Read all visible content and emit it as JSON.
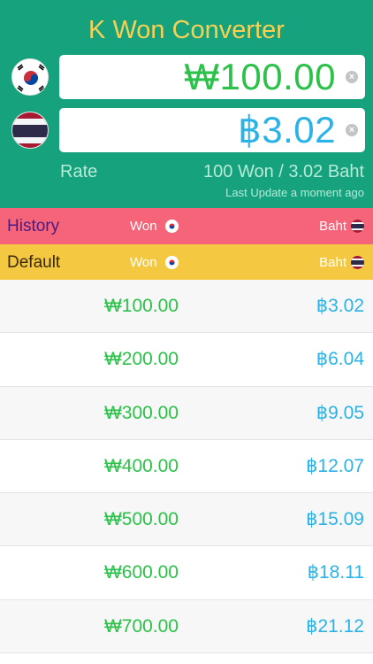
{
  "header": {
    "title": "K Won Converter",
    "won_value": "₩100.00",
    "baht_value": "฿3.02",
    "rate_label": "Rate",
    "rate_value": "100 Won / 3.02 Baht",
    "last_update": "Last Update a moment ago",
    "won_color": "#2cc24a",
    "baht_color": "#2bb2e6",
    "bg_color": "#16a27c"
  },
  "bars": {
    "history": {
      "label": "History",
      "won": "Won",
      "baht": "Baht",
      "color": "#f56478"
    },
    "default": {
      "label": "Default",
      "won": "Won",
      "baht": "Baht",
      "color": "#f5c842"
    }
  },
  "rows": [
    {
      "won": "₩100.00",
      "baht": "฿3.02"
    },
    {
      "won": "₩200.00",
      "baht": "฿6.04"
    },
    {
      "won": "₩300.00",
      "baht": "฿9.05"
    },
    {
      "won": "₩400.00",
      "baht": "฿12.07"
    },
    {
      "won": "₩500.00",
      "baht": "฿15.09"
    },
    {
      "won": "₩600.00",
      "baht": "฿18.11"
    },
    {
      "won": "₩700.00",
      "baht": "฿21.12"
    }
  ]
}
